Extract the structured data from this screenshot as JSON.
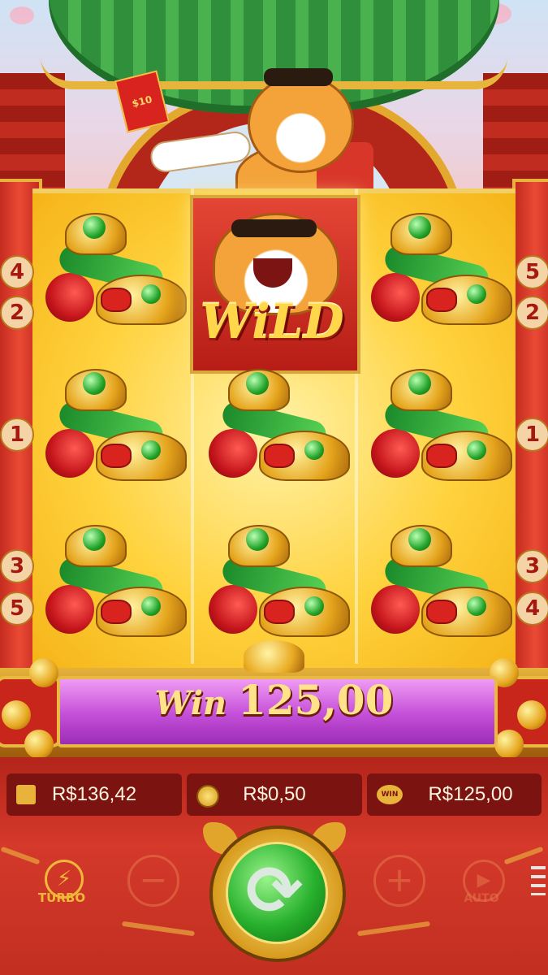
{
  "envelope_label": "$10",
  "wild_label": "WiLD",
  "win_banner": {
    "prefix": "Win",
    "amount": "125,00"
  },
  "paylines": {
    "left": [
      "4",
      "2",
      "1",
      "3",
      "5"
    ],
    "right": [
      "5",
      "2",
      "1",
      "3",
      "4"
    ]
  },
  "balances": {
    "wallet_value": "R$136,42",
    "bet_value": "R$0,50",
    "win_value": "R$125,00",
    "win_icon_label": "WIN"
  },
  "controls": {
    "turbo_label": "TURBO",
    "auto_label": "AUTO",
    "minus_symbol": "−",
    "plus_symbol": "+",
    "turbo_symbol": "⚡",
    "auto_symbol": "▶"
  },
  "reel_symbols": [
    [
      "gold-ingot-jade",
      "wild",
      "gold-ingot-jade"
    ],
    [
      "gold-ingot-jade",
      "gold-ingot-jade",
      "gold-ingot-jade"
    ],
    [
      "gold-ingot-jade",
      "gold-ingot-jade",
      "gold-ingot-jade"
    ]
  ],
  "colors": {
    "win_banner": "#c44ed8",
    "spin_button": "#28b12d",
    "frame_gold": "#e8b23b",
    "panel_red": "#c22f21"
  }
}
